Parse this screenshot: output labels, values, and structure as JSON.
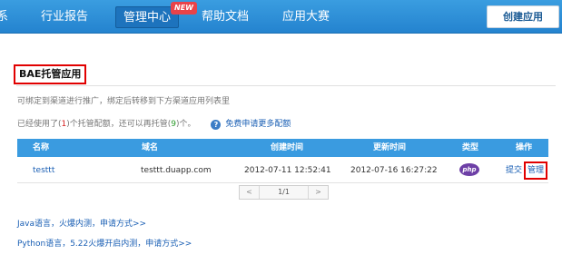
{
  "nav": {
    "cut_label": "系",
    "reports": "行业报告",
    "manage": "管理中心",
    "badge": "NEW",
    "docs": "帮助文档",
    "contest": "应用大赛",
    "create_app": "创建应用"
  },
  "section": {
    "title": "BAE托管应用",
    "hint": "可绑定到渠道进行推广，绑定后转移到下方渠道应用列表里",
    "quota_prefix": "已经使用了(",
    "quota_used": "1",
    "quota_middle": ")个托管配额，还可以再托管(",
    "quota_left": "9",
    "quota_suffix": ")个。",
    "quota_link": "免费申请更多配额"
  },
  "table": {
    "columns": [
      "名称",
      "域名",
      "创建时间",
      "更新时间",
      "类型",
      "操作"
    ],
    "rows": [
      {
        "name": "testtt",
        "domain": "testtt.duapp.com",
        "created": "2012-07-11 12:52:41",
        "updated": "2012-07-16 16:27:22",
        "type": "php",
        "op_submit": "提交",
        "op_manage": "管理"
      }
    ]
  },
  "pager": {
    "prev": "<",
    "label": "1/1",
    "next": ">"
  },
  "links": {
    "java": "Java语言，火爆内测，申请方式>>",
    "python": "Python语言，5.22火爆开启内测，申请方式>>"
  },
  "colors": {
    "nav_bg": "#2a8ad6",
    "table_head": "#3a9be0",
    "highlight": "#e10000",
    "link": "#1a5fb4"
  }
}
